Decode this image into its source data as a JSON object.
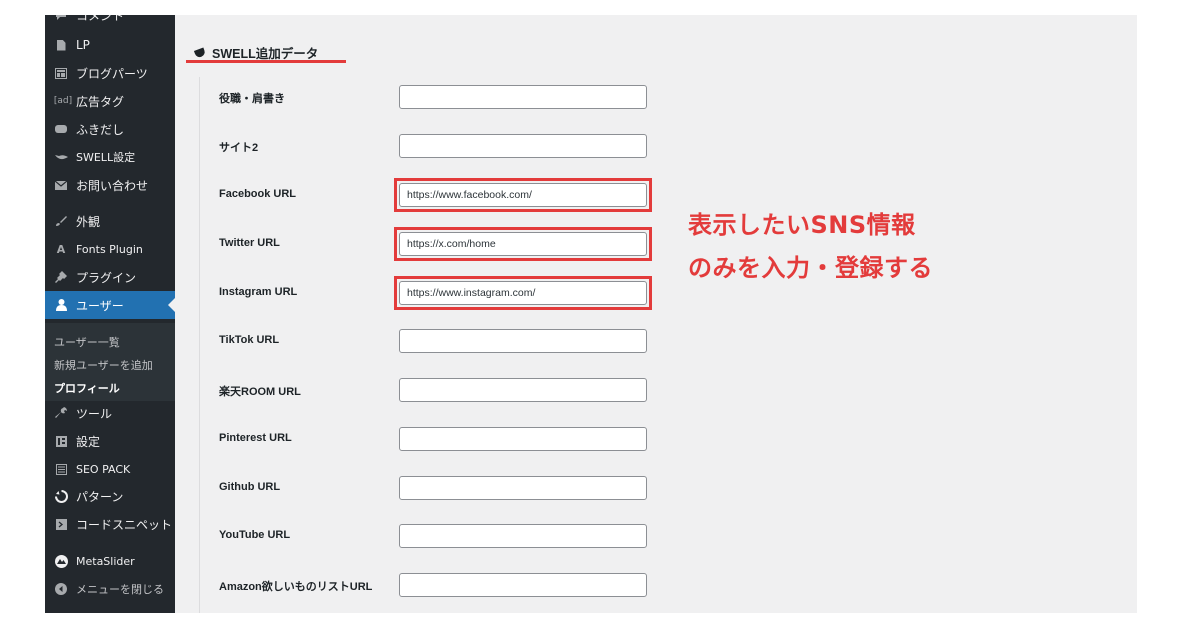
{
  "sidebar": {
    "items": [
      {
        "label": "コメント",
        "icon": "comment-icon"
      },
      {
        "label": "LP",
        "icon": "page-icon"
      },
      {
        "label": "ブログパーツ",
        "icon": "blog-parts-icon"
      },
      {
        "label": "広告タグ",
        "icon": "ad-tag-icon",
        "icon_text": "[ad]"
      },
      {
        "label": "ふきだし",
        "icon": "speech-bubble-icon"
      },
      {
        "label": "SWELL設定",
        "icon": "swell-bird-icon"
      },
      {
        "label": "お問い合わせ",
        "icon": "mail-icon"
      },
      {
        "label": "外観",
        "icon": "appearance-brush-icon"
      },
      {
        "label": "Fonts Plugin",
        "icon": "fonts-plugin-icon",
        "icon_text": "A"
      },
      {
        "label": "プラグイン",
        "icon": "plugin-icon"
      },
      {
        "label": "ユーザー",
        "icon": "user-icon"
      },
      {
        "label": "ツール",
        "icon": "wrench-icon"
      },
      {
        "label": "設定",
        "icon": "settings-icon"
      },
      {
        "label": "SEO PACK",
        "icon": "seo-pack-icon"
      },
      {
        "label": "パターン",
        "icon": "pattern-icon"
      },
      {
        "label": "コードスニペット",
        "icon": "code-snippet-icon"
      },
      {
        "label": "MetaSlider",
        "icon": "metaslider-icon"
      },
      {
        "label": "メニューを閉じる",
        "icon": "collapse-menu-icon"
      }
    ],
    "submenu": [
      "ユーザー一覧",
      "新規ユーザーを追加",
      "プロフィール"
    ]
  },
  "section": {
    "title": "SWELL追加データ"
  },
  "fields": [
    {
      "label": "役職・肩書き",
      "value": ""
    },
    {
      "label": "サイト2",
      "value": ""
    },
    {
      "label": "Facebook URL",
      "value": "https://www.facebook.com/"
    },
    {
      "label": "Twitter URL",
      "value": "https://x.com/home"
    },
    {
      "label": "Instagram URL",
      "value": "https://www.instagram.com/"
    },
    {
      "label": "TikTok URL",
      "value": ""
    },
    {
      "label": "楽天ROOM URL",
      "value": ""
    },
    {
      "label": "Pinterest URL",
      "value": ""
    },
    {
      "label": "Github URL",
      "value": ""
    },
    {
      "label": "YouTube URL",
      "value": ""
    },
    {
      "label": "Amazon欲しいものリストURL",
      "value": ""
    }
  ],
  "annotation": {
    "line1": "表示したいSNS情報",
    "line2": "のみを入力・登録する",
    "color": "#e33b3b"
  },
  "colors": {
    "sidebar": "#23282d",
    "active": "#2271b1",
    "content_bg": "#f0f0f1",
    "highlight": "#e33b3b"
  }
}
